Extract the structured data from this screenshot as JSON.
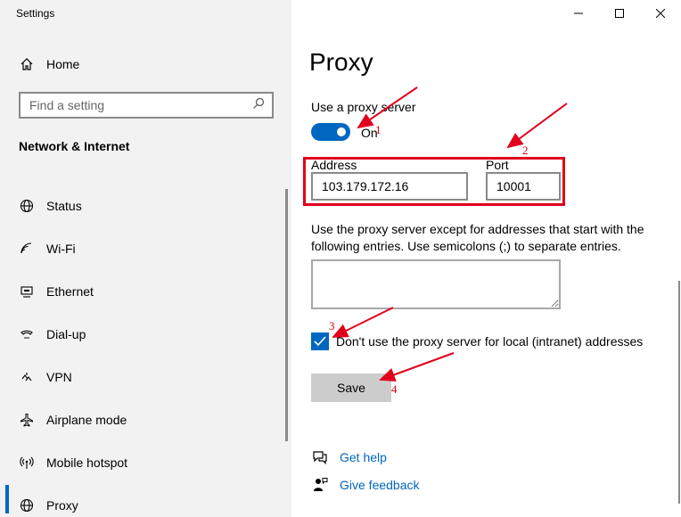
{
  "window": {
    "title": "Settings",
    "controls": [
      "minimize",
      "maximize",
      "close"
    ]
  },
  "sidebar": {
    "home_label": "Home",
    "search": {
      "placeholder": "Find a setting",
      "value": ""
    },
    "section_title": "Network & Internet",
    "items": [
      {
        "label": "Status",
        "icon": "globe-status-icon"
      },
      {
        "label": "Wi-Fi",
        "icon": "wifi-icon"
      },
      {
        "label": "Ethernet",
        "icon": "ethernet-icon"
      },
      {
        "label": "Dial-up",
        "icon": "dialup-icon"
      },
      {
        "label": "VPN",
        "icon": "vpn-icon"
      },
      {
        "label": "Airplane mode",
        "icon": "airplane-icon"
      },
      {
        "label": "Mobile hotspot",
        "icon": "hotspot-icon"
      },
      {
        "label": "Proxy",
        "icon": "globe-icon",
        "active": true
      }
    ]
  },
  "main": {
    "title": "Proxy",
    "use_proxy": {
      "label": "Use a proxy server",
      "state": "On",
      "enabled": true
    },
    "address": {
      "label": "Address",
      "value": "103.179.172.16"
    },
    "port": {
      "label": "Port",
      "value": "10001"
    },
    "exceptions": {
      "description": "Use the proxy server except for addresses that start with the following entries. Use semicolons (;) to separate entries.",
      "value": ""
    },
    "bypass_local": {
      "label": "Don't use the proxy server for local (intranet) addresses",
      "checked": true
    },
    "save_label": "Save",
    "links": {
      "help": "Get help",
      "feedback": "Give feedback"
    }
  },
  "annotations": {
    "numbers": [
      "1",
      "2",
      "3",
      "4"
    ],
    "color": "#e0001b"
  },
  "colors": {
    "accent": "#0067c0",
    "sidebar_bg": "#f2f2f2",
    "save_bg": "#cccccc"
  }
}
